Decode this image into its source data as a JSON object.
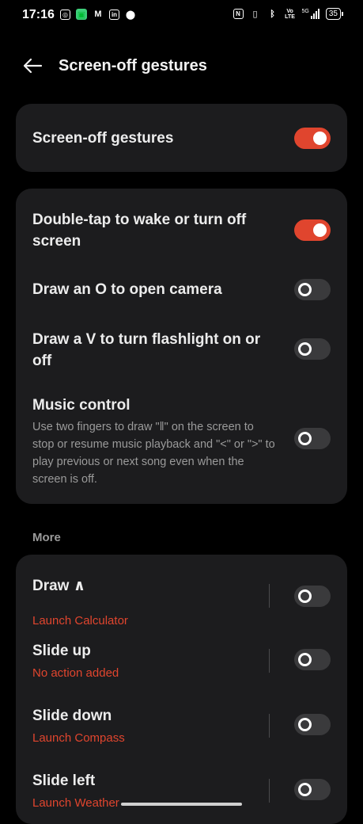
{
  "status_bar": {
    "time": "17:16",
    "network": "5G",
    "volte": "Vo LTE",
    "battery": "35"
  },
  "header": {
    "title": "Screen-off gestures"
  },
  "master": {
    "label": "Screen-off gestures",
    "enabled": true
  },
  "gestures": [
    {
      "label": "Double-tap to wake or turn off screen",
      "enabled": true
    },
    {
      "label": "Draw an O to open camera",
      "enabled": false
    },
    {
      "label": "Draw a V to turn flashlight on or off",
      "enabled": false
    },
    {
      "label": "Music control",
      "description": "Use two fingers to draw \"‖\" on the screen to stop or resume music playback and \"<\" or \">\" to play previous or next song even when the screen is off.",
      "enabled": false
    }
  ],
  "more": {
    "section_label": "More",
    "items": [
      {
        "label": "Draw ∧",
        "action": "Launch Calculator",
        "enabled": false
      },
      {
        "label": "Slide up",
        "action": "No action added",
        "enabled": false
      },
      {
        "label": "Slide down",
        "action": "Launch Compass",
        "enabled": false
      },
      {
        "label": "Slide left",
        "action": "Launch Weather",
        "enabled": false
      }
    ]
  },
  "colors": {
    "accent": "#e0452e",
    "card": "#1c1c1e",
    "background": "#000000"
  }
}
